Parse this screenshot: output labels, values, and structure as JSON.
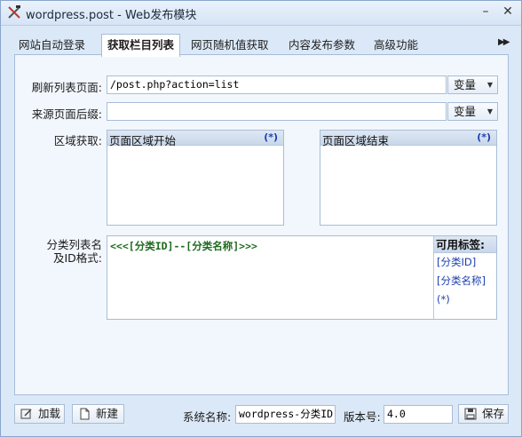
{
  "window": {
    "title": "wordpress.post - Web发布模块",
    "minimize": "–",
    "close": "✕"
  },
  "tabs": [
    {
      "label": "网站自动登录"
    },
    {
      "label": "获取栏目列表"
    },
    {
      "label": "网页随机值获取"
    },
    {
      "label": "内容发布参数"
    },
    {
      "label": "高级功能"
    }
  ],
  "tab_scroll": "▶▶",
  "form": {
    "refresh_label": "刷新列表页面:",
    "refresh_value": "/post.php?action=list",
    "refresh_var": "变量",
    "suffix_label": "来源页面后缀:",
    "suffix_value": "",
    "suffix_var": "变量",
    "region_label": "区域获取:",
    "region_start_title": "页面区域开始",
    "region_start_tag": "(*)",
    "region_end_title": "页面区域结束",
    "region_end_tag": "(*)",
    "format_label_1": "分类列表名",
    "format_label_2": "及ID格式:",
    "format_value": "<<<[分类ID]--[分类名称]>>>",
    "tags_title": "可用标签:",
    "tags": [
      "[分类ID]",
      "[分类名称]",
      "(*)"
    ]
  },
  "bottom": {
    "load": "加载",
    "new": "新建",
    "system_name_label": "系统名称:",
    "system_name_value": "wordpress-分类ID",
    "version_label": "版本号:",
    "version_value": "4.0",
    "save": "保存"
  }
}
